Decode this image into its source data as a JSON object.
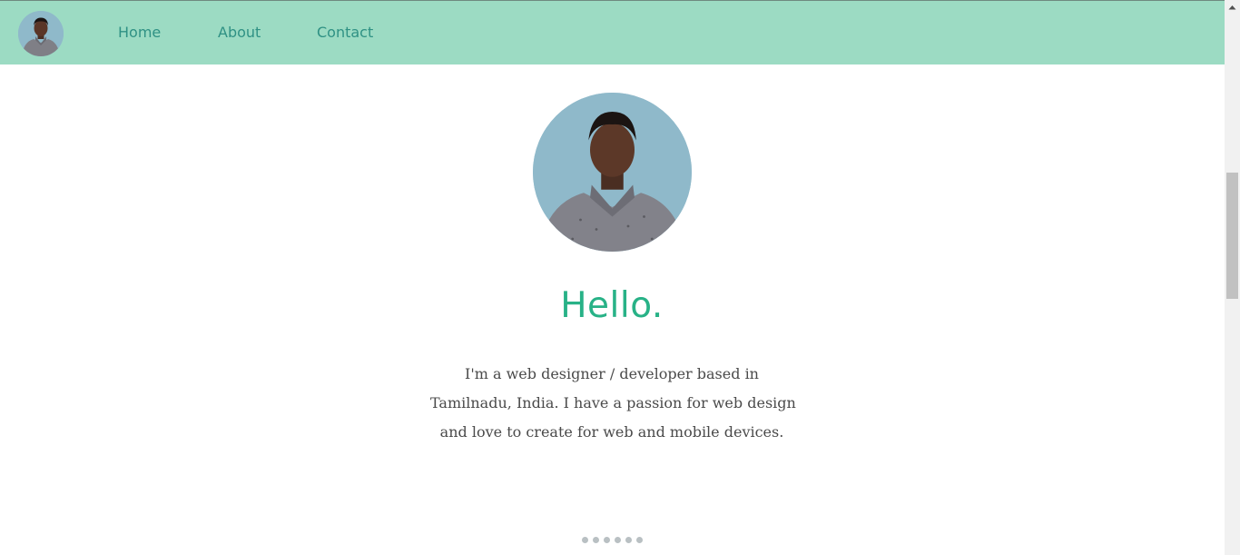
{
  "nav": {
    "avatar_icon": "person-photo-icon",
    "links": [
      {
        "label": "Home"
      },
      {
        "label": "About"
      },
      {
        "label": "Contact"
      }
    ],
    "background_color": "#9cdbc3",
    "link_color": "#2f9184"
  },
  "hero": {
    "photo_icon": "person-photo-icon",
    "title": "Hello.",
    "title_color": "#28b287",
    "description_lines": [
      "I'm a web designer / developer based in",
      "Tamilnadu, India. I have a passion for web design",
      "and love to create for web and mobile devices."
    ]
  },
  "pagination": {
    "dot_count": 6,
    "dot_color": "#b9c0c3"
  },
  "scrollbar": {
    "arrow_icon": "scroll-up-arrow-icon"
  }
}
